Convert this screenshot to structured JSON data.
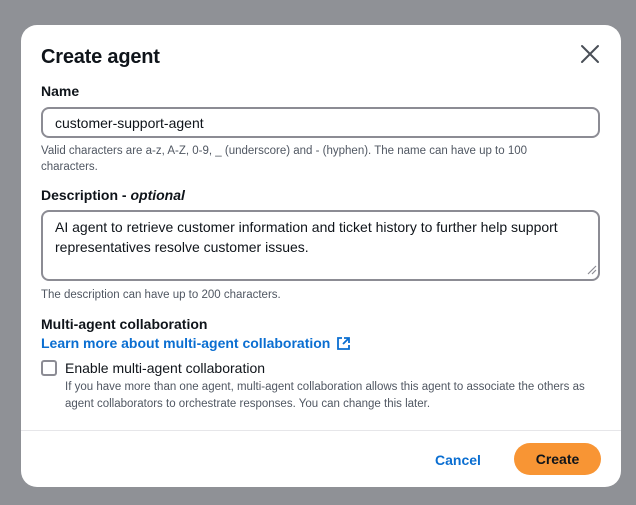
{
  "dialog": {
    "title": "Create agent",
    "close_icon": "close-icon"
  },
  "name_field": {
    "label": "Name",
    "value": "customer-support-agent",
    "hint": "Valid characters are a-z, A-Z, 0-9, _ (underscore) and - (hyphen). The name can have up to 100 characters."
  },
  "description_field": {
    "label": "Description - ",
    "label_optional": "optional",
    "value": "AI agent to retrieve customer information and ticket history to further help support representatives resolve customer issues.",
    "hint": "The description can have up to 200 characters."
  },
  "collaboration": {
    "heading": "Multi-agent collaboration",
    "learn_more_link": "Learn more about multi-agent collaboration",
    "link_icon": "external-link-icon",
    "checkbox_label": "Enable multi-agent collaboration",
    "checkbox_checked": false,
    "checkbox_hint": "If you have more than one agent, multi-agent collaboration allows this agent to associate the others as agent collaborators to orchestrate responses. You can change this later."
  },
  "footer": {
    "cancel_label": "Cancel",
    "create_label": "Create"
  },
  "colors": {
    "link": "#0a6ed1",
    "primary_button": "#f89534",
    "backdrop": "#8f9196"
  }
}
